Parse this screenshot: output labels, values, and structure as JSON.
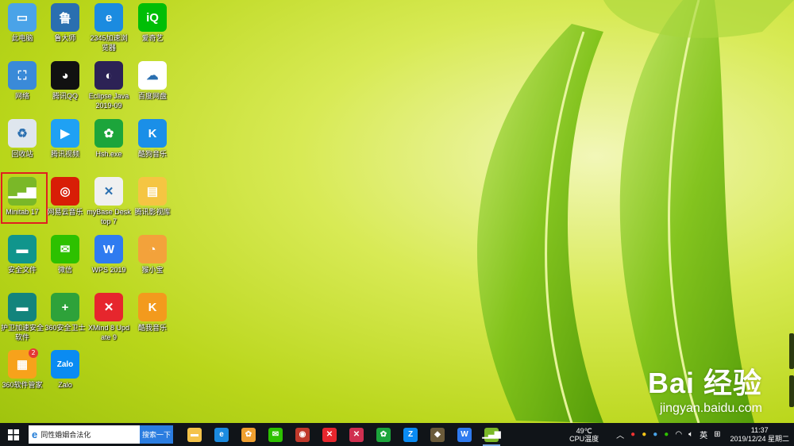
{
  "desktop_icons": [
    {
      "label": "此电脑",
      "icon": "computer-icon",
      "color": "#4aa3e8"
    },
    {
      "label": "鲁大师",
      "icon": "ludashi-icon",
      "color": "#2a6fb0"
    },
    {
      "label": "2345加速浏览器",
      "icon": "ie-browser-icon",
      "color": "#1b8be0"
    },
    {
      "label": "爱奇艺",
      "icon": "iqiyi-icon",
      "color": "#00be06"
    },
    {
      "label": "网络",
      "icon": "network-icon",
      "color": "#3a8ad8"
    },
    {
      "label": "腾讯QQ",
      "icon": "qq-penguin-icon",
      "color": "#111111"
    },
    {
      "label": "Eclipse Java 2019-09",
      "icon": "eclipse-icon",
      "color": "#2c2255"
    },
    {
      "label": "百度网盘",
      "icon": "baidu-netdisk-icon",
      "color": "#ffffff"
    },
    {
      "label": "回收站",
      "icon": "recycle-bin-icon",
      "color": "#dfe6ee"
    },
    {
      "label": "腾讯视频",
      "icon": "tencent-video-icon",
      "color": "#1fa1f4"
    },
    {
      "label": "Hsh.exe",
      "icon": "green-swirl-icon",
      "color": "#1ca53b"
    },
    {
      "label": "酷狗音乐",
      "icon": "kugou-icon",
      "color": "#1a8fe8"
    },
    {
      "label": "Minitab 17",
      "icon": "minitab-icon",
      "color": "#7ab828"
    },
    {
      "label": "网易云音乐",
      "icon": "netease-music-icon",
      "color": "#d81e06"
    },
    {
      "label": "myBase Desktop 7",
      "icon": "mybase-icon",
      "color": "#f0f0f0"
    },
    {
      "label": "腾讯影视库",
      "icon": "video-folder-icon",
      "color": "#f5c542"
    },
    {
      "label": "安全文件",
      "icon": "safe-file-icon",
      "color": "#10958c"
    },
    {
      "label": "微信",
      "icon": "wechat-icon",
      "color": "#2dc100"
    },
    {
      "label": "WPS 2019",
      "icon": "wps-icon",
      "color": "#2f7bf0"
    },
    {
      "label": "猴小宝",
      "icon": "monkey-icon",
      "color": "#f3a23b"
    },
    {
      "label": "护卫加速安全软件",
      "icon": "shield-app-icon",
      "color": "#13847c"
    },
    {
      "label": "360安全卫士",
      "icon": "360-safe-icon",
      "color": "#2ea23a"
    },
    {
      "label": "XMind 8 Update 9",
      "icon": "xmind-icon",
      "color": "#e6262d"
    },
    {
      "label": "酷我音乐",
      "icon": "kuwo-icon",
      "color": "#f39a1d"
    },
    {
      "label": "360软件管家",
      "icon": "360-software-icon",
      "color": "#f7a21b"
    },
    {
      "label": "Zalo",
      "icon": "zalo-icon",
      "color": "#0a8bf2"
    }
  ],
  "icon_glyphs": [
    "▭",
    "鲁",
    "e",
    "iQ",
    "⛶",
    "◕",
    "◐",
    "☁",
    "♻",
    "▶",
    "✿",
    "K",
    "▁▃▆",
    "◎",
    "✕",
    "▤",
    "▬",
    "✉",
    "W",
    "◔",
    "▬",
    "+",
    "✕",
    "K",
    "▦",
    "Zalo"
  ],
  "badge_count": "2",
  "watermark": {
    "brand": "Bai 经验",
    "url": "jingyan.baidu.com"
  },
  "taskbar": {
    "search_text": "同性婚姻合法化",
    "search_button": "搜索一下",
    "pinned": [
      {
        "name": "file-explorer-icon",
        "color": "#f4c34a",
        "glyph": "▬"
      },
      {
        "name": "ie-icon",
        "color": "#1b8be0",
        "glyph": "e"
      },
      {
        "name": "photo-app-icon",
        "color": "#f0a030",
        "glyph": "✿"
      },
      {
        "name": "wechat-icon",
        "color": "#2dc100",
        "glyph": "✉"
      },
      {
        "name": "screenshot-app-icon",
        "color": "#c0392b",
        "glyph": "◉"
      },
      {
        "name": "xmind-icon",
        "color": "#e6262d",
        "glyph": "✕"
      },
      {
        "name": "mybase-icon",
        "color": "#d03050",
        "glyph": "✕"
      },
      {
        "name": "green-swirl-icon",
        "color": "#1ca53b",
        "glyph": "✿"
      },
      {
        "name": "zalo-icon",
        "color": "#0a8bf2",
        "glyph": "Z"
      },
      {
        "name": "game-icon",
        "color": "#6b5b3a",
        "glyph": "◆"
      },
      {
        "name": "wps-icon",
        "color": "#2f7bf0",
        "glyph": "W"
      },
      {
        "name": "minitab-icon",
        "color": "#7ab828",
        "glyph": "▁▃▆"
      }
    ],
    "temperature": "49℃",
    "temp_label": "CPU温度",
    "ime": "英",
    "time": "11:37",
    "date": "2019/12/24 星期二"
  }
}
